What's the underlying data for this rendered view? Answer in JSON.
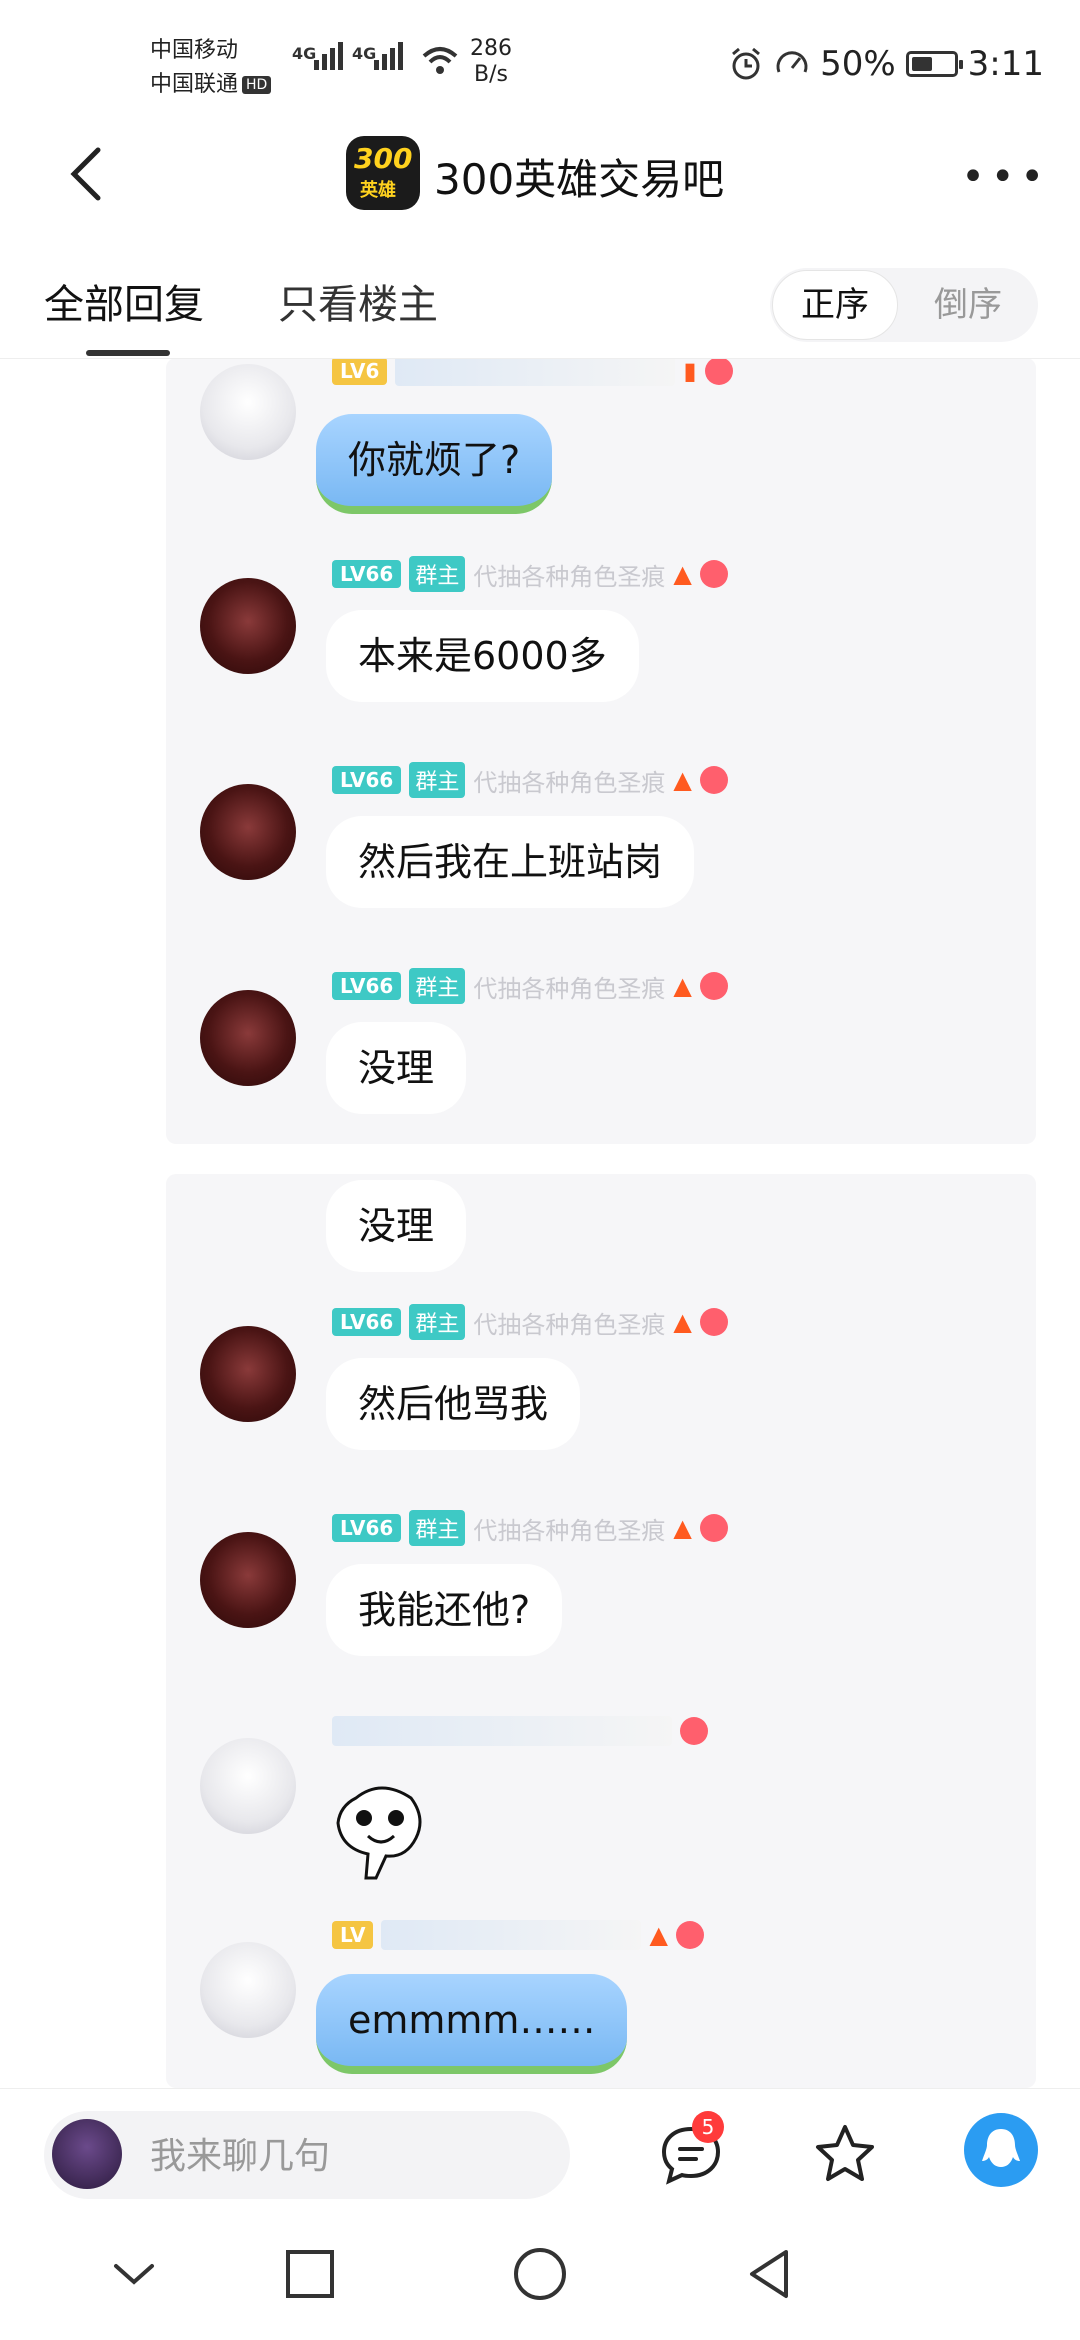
{
  "status_bar": {
    "carrier1": "中国移动",
    "carrier2": "中国联通",
    "hd": "HD",
    "net1": "4G",
    "net2": "4G",
    "speed_value": "286",
    "speed_unit": "B/s",
    "battery": "50%",
    "battery_level": 0.5,
    "time": "3:11"
  },
  "header": {
    "title": "300英雄交易吧",
    "logo_text_top": "300",
    "logo_text_bottom": "英雄"
  },
  "tabs": {
    "all": "全部回复",
    "owner_only": "只看楼主",
    "sort_asc": "正序",
    "sort_desc": "倒序"
  },
  "chat": {
    "level": "LV66",
    "owner_badge": "群主",
    "tagline": "代抽各种角色圣痕",
    "shot1": [
      {
        "text": "你就烦了?"
      },
      {
        "text": "本来是6000多"
      },
      {
        "text": "然后我在上班站岗"
      },
      {
        "text": "没理"
      }
    ],
    "shot2": [
      {
        "text": "没理"
      },
      {
        "text": "然后他骂我"
      },
      {
        "text": "我能还他?"
      },
      {
        "text": "emmmm……"
      }
    ],
    "level_partial": "LV6"
  },
  "bottom_bar": {
    "placeholder": "我来聊几句",
    "message_badge": "5"
  },
  "icons": {
    "back": "chevron-left-icon",
    "more": "more-icon",
    "comment": "comment-icon",
    "star": "star-icon",
    "qq": "qq-icon",
    "nav_back": "triangle-back-icon",
    "nav_home": "circle-home-icon",
    "nav_recents": "square-recents-icon",
    "nav_down": "chevron-down-icon"
  }
}
